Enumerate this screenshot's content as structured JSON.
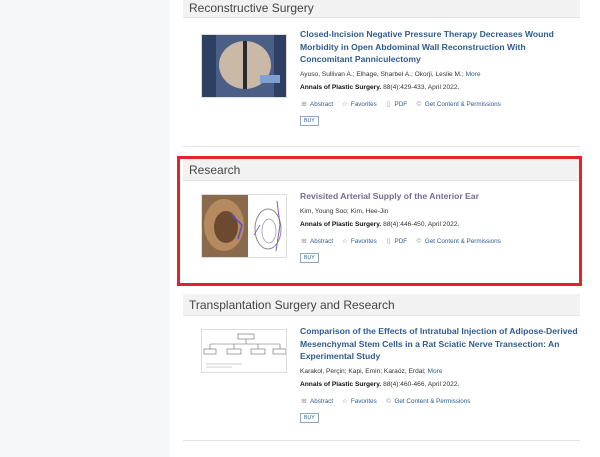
{
  "colors": {
    "link": "#2f5c8f",
    "highlight": "#e2232a"
  },
  "sections": [
    {
      "header": "Reconstructive Surgery",
      "article": {
        "title": "Closed-Incision Negative Pressure Therapy Decreases Wound Morbidity in Open Abdominal Wall Reconstruction With Concomitant Panniculectomy",
        "authors": "Ayuso, Sullivan A.; Elhage, Sharbel A.; Okorji, Leslie M.;",
        "more": "More",
        "journal_name": "Annals of Plastic Surgery.",
        "citation": " 88(4):429-433, April 2022."
      }
    },
    {
      "header": "Research",
      "article": {
        "title": "Revisited Arterial Supply of the Anterior Ear",
        "authors": "Kim, Young Soo; Kim, Hee-Jin",
        "journal_name": "Annals of Plastic Surgery.",
        "citation": " 88(4):446-450, April 2022."
      }
    },
    {
      "header": "Transplantation Surgery and Research",
      "article": {
        "title": "Comparison of the Effects of Intratubal Injection of Adipose-Derived Mesenchymal Stem Cells in a Rat Sciatic Nerve Transection: An Experimental Study",
        "authors": "Karakol, Perçin; Kapi, Emin; Karaöz, Erdal;",
        "more": "More",
        "journal_name": "Annals of Plastic Surgery.",
        "citation": " 88(4):460-466, April 2022."
      }
    }
  ],
  "actions": {
    "abstract": "Abstract",
    "favorites": "Favorites",
    "pdf": "PDF",
    "permissions": "Get Content & Permissions",
    "buy": "BUY"
  },
  "icons": {
    "abstract": "plus-square-icon",
    "favorites": "star-icon",
    "pdf": "pdf-file-icon",
    "permissions": "copyright-icon"
  }
}
